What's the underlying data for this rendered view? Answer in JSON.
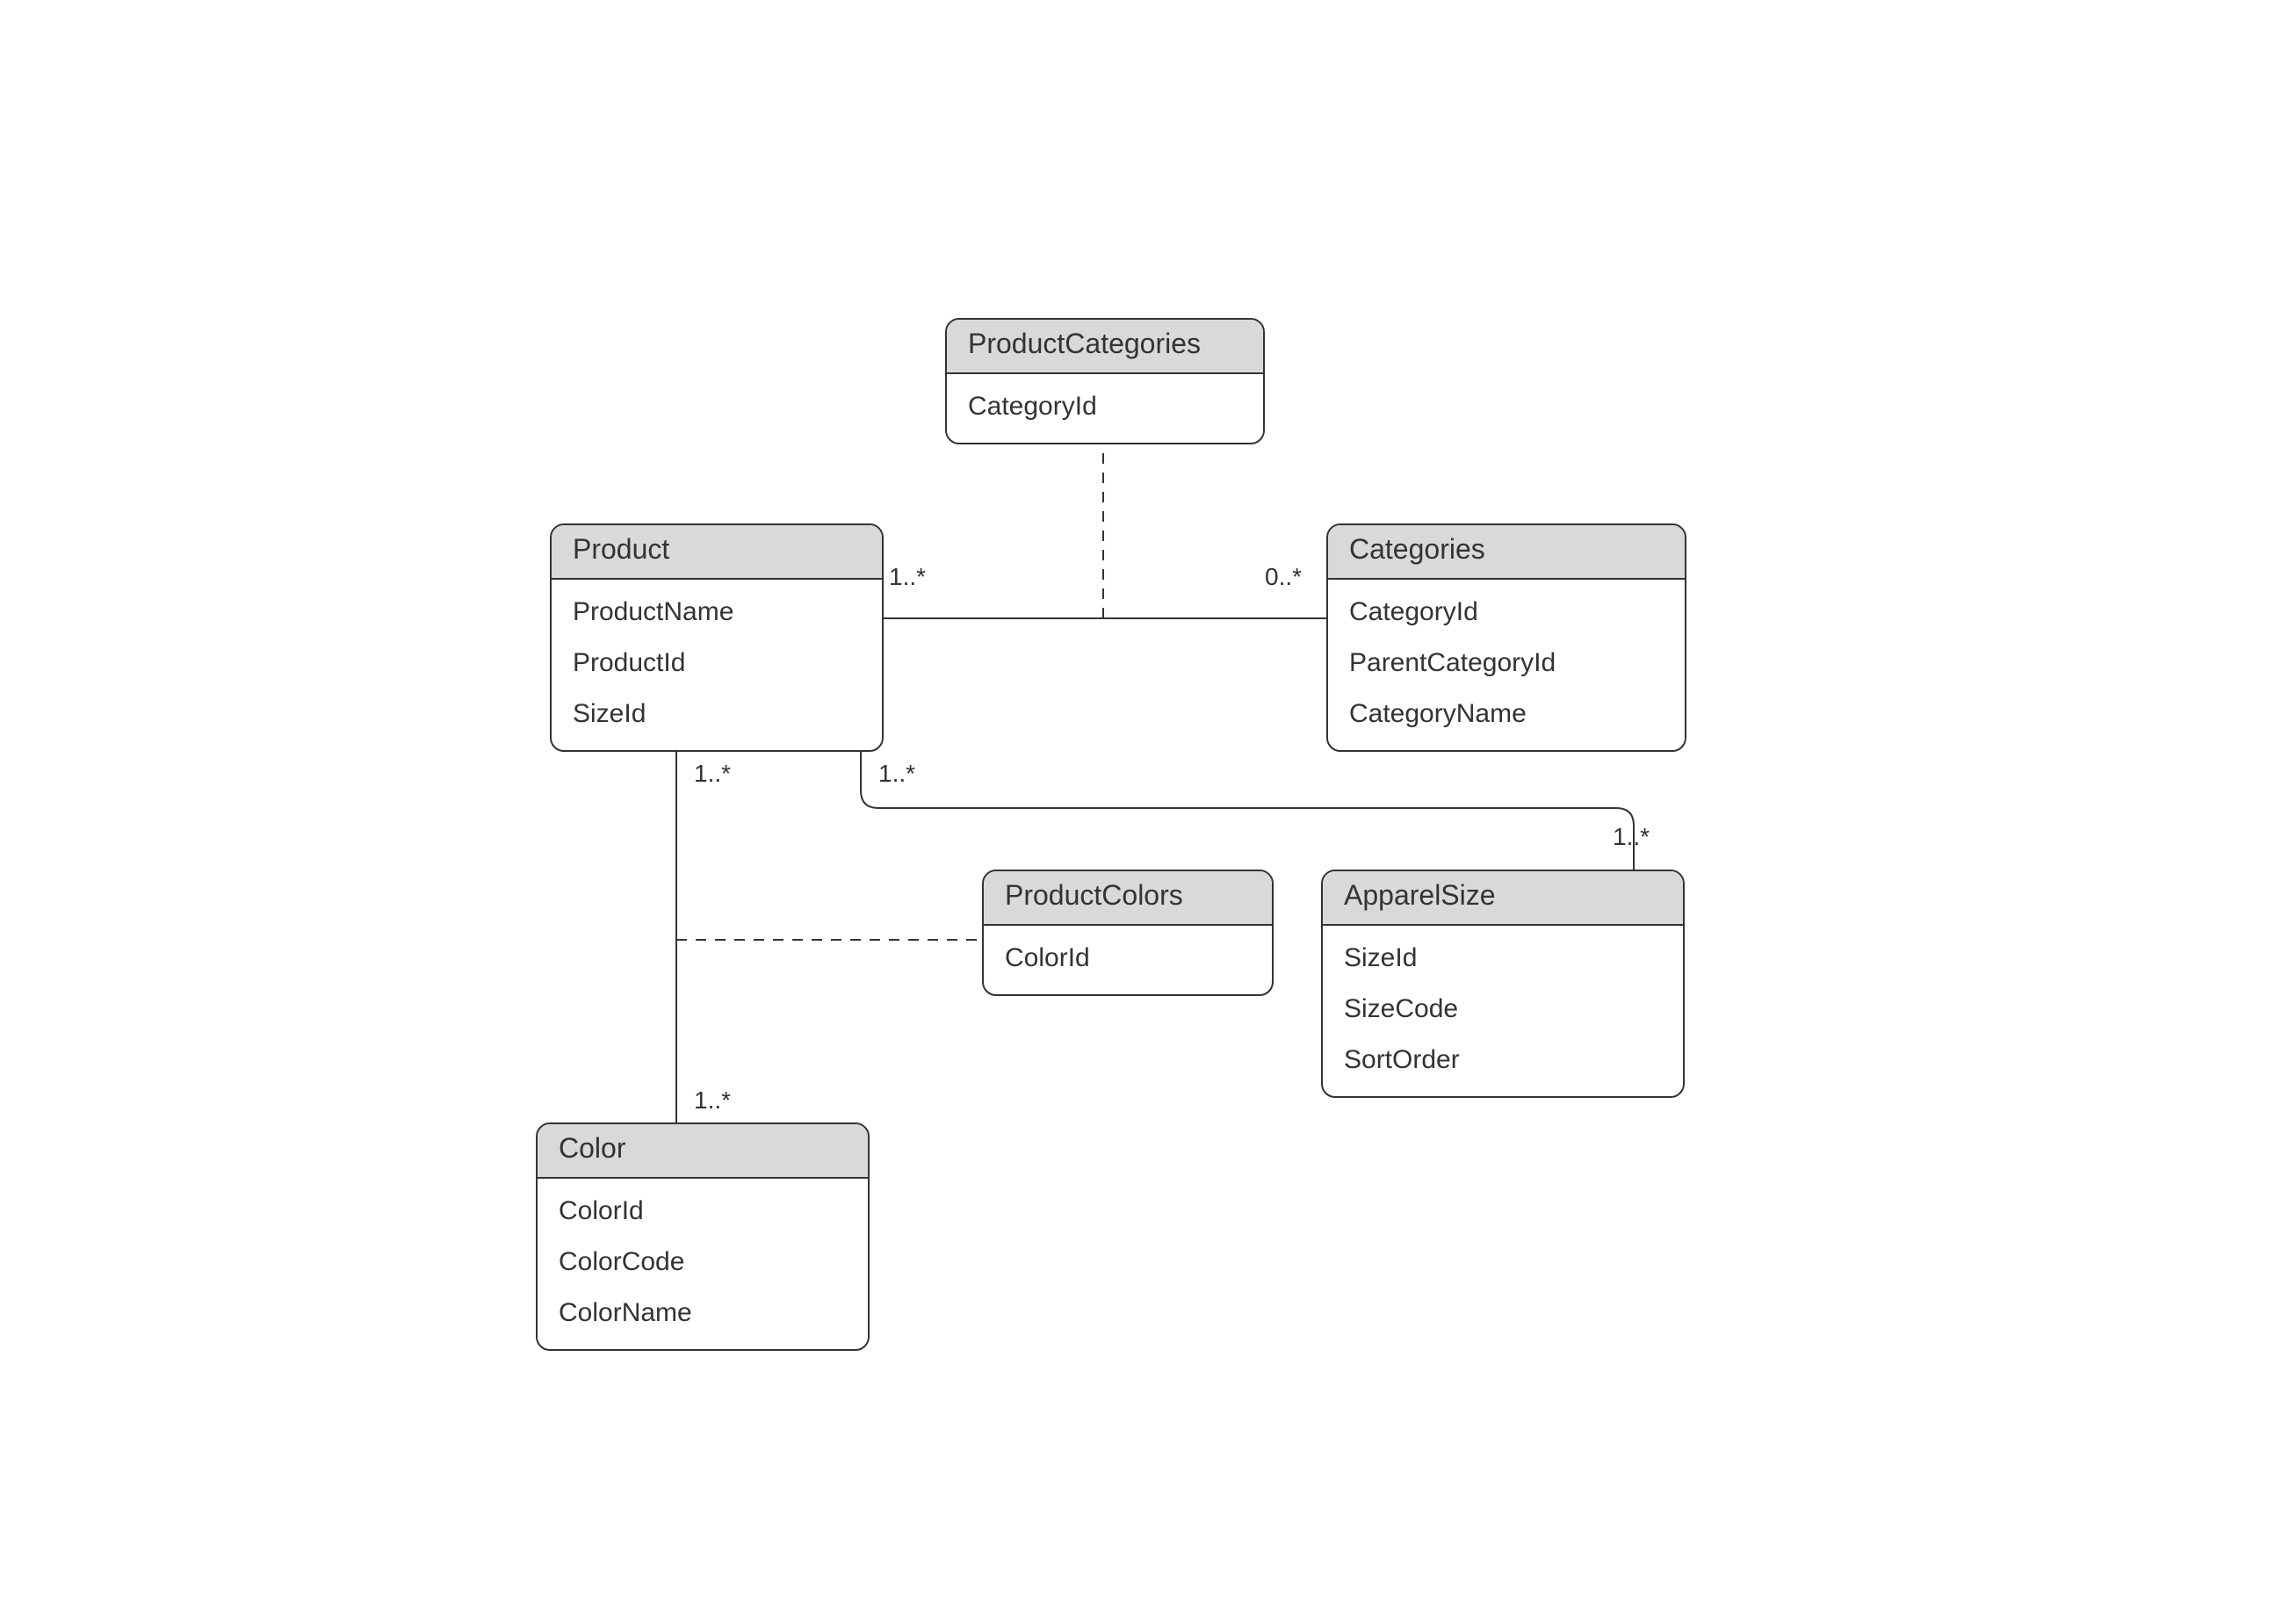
{
  "entities": {
    "productCategories": {
      "title": "ProductCategories",
      "fields": [
        "CategoryId"
      ]
    },
    "product": {
      "title": "Product",
      "fields": [
        "ProductName",
        "ProductId",
        "SizeId"
      ]
    },
    "categories": {
      "title": "Categories",
      "fields": [
        "CategoryId",
        "ParentCategoryId",
        "CategoryName"
      ]
    },
    "productColors": {
      "title": "ProductColors",
      "fields": [
        "ColorId"
      ]
    },
    "apparelSize": {
      "title": "ApparelSize",
      "fields": [
        "SizeId",
        "SizeCode",
        "SortOrder"
      ]
    },
    "color": {
      "title": "Color",
      "fields": [
        "ColorId",
        "ColorCode",
        "ColorName"
      ]
    }
  },
  "multiplicities": {
    "productToCategories_left": "1..*",
    "productToCategories_right": "0..*",
    "productToColor_top": "1..*",
    "productToColor_bottom": "1..*",
    "productToSize_left": "1..*",
    "productToSize_right": "1..*"
  }
}
